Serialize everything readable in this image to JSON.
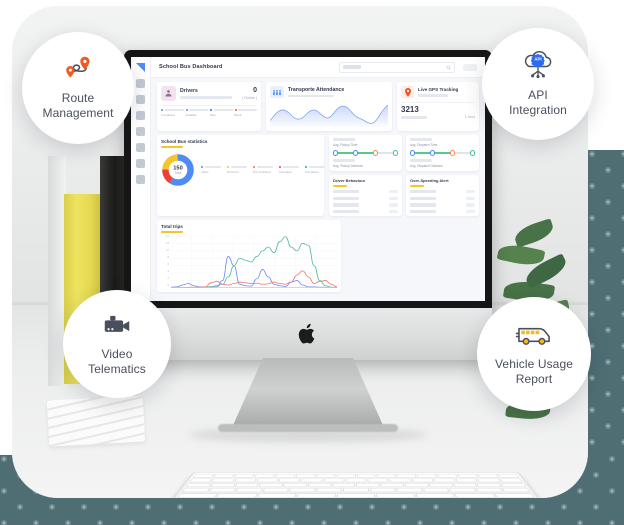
{
  "badges": [
    {
      "id": "route-management",
      "label": "Route\nManagement",
      "icon": "map-pin-route-icon",
      "icon_color": "#ef5a22"
    },
    {
      "id": "api-integration",
      "label": "API\nIntegration",
      "icon": "api-cloud-icon",
      "icon_color": "#2a6df4",
      "icon_text": "API"
    },
    {
      "id": "video-telematics",
      "label": "Video\nTelematics",
      "icon": "video-camera-icon",
      "icon_color": "#4a4f5c"
    },
    {
      "id": "vehicle-usage-report",
      "label": "Vehicle Usage\nReport",
      "icon": "school-bus-icon",
      "icon_color": "#f5b91d"
    }
  ],
  "dashboard": {
    "title": "School Bus Dashboard",
    "search": {
      "placeholder": "",
      "icon": "search-icon"
    },
    "sidebar": {
      "item_count": 8,
      "active_index": 0
    },
    "cards": {
      "drivers": {
        "title": "Drivers",
        "value": "0",
        "status": "( Online )",
        "icon": "driver-avatar-icon",
        "footer": [
          {
            "label": "Completed",
            "color": "#4e8cf5"
          },
          {
            "label": "Available",
            "color": "#4e8cf5"
          },
          {
            "label": "New",
            "color": "#2a6df4"
          },
          {
            "label": "Block",
            "color": "#ef5a22"
          }
        ]
      },
      "attendance": {
        "title": "Transporte Attendance",
        "icon": "attendance-people-icon",
        "chart": {
          "type": "area",
          "points": [
            6,
            12,
            9,
            14,
            10,
            8,
            13,
            20,
            16,
            9,
            5,
            10,
            16,
            20,
            14,
            7,
            3,
            2,
            9,
            18,
            20
          ]
        }
      },
      "gps": {
        "title": "Live GPS Tracking",
        "icon": "gps-pin-icon",
        "value": "3213",
        "time": "1 hour"
      },
      "statistics": {
        "title": "School Bus statistics",
        "donut_value": "150",
        "donut_caption": "Total",
        "legend": [
          {
            "label": "Active",
            "color": "#4e8cf5"
          },
          {
            "label": "No Driver",
            "color": "#f6c52a"
          },
          {
            "label": "Not confirmed",
            "color": "#f0703c"
          },
          {
            "label": "Cancelled",
            "color": "#ea4335"
          },
          {
            "label": "Completed",
            "color": "#1fa9a0"
          }
        ]
      },
      "total_trips": {
        "title": "Total trips"
      },
      "avg_pickup_time": {
        "label": "Avg. Pickup Time"
      },
      "avg_pickup_distance": {
        "label": "Avg. Pickup Distance"
      },
      "avg_dispatch_time": {
        "label": "Avg. Dispatch Time"
      },
      "avg_dispatch_distance": {
        "label": "Avg. Dispatch Distance"
      },
      "driver_behaviour": {
        "title": "Driver Behaviour",
        "row_count": 4
      },
      "over_speeding": {
        "title": "Over-Speeding Alert",
        "row_count": 4
      }
    }
  },
  "chart_data": {
    "type": "line",
    "title": "Total trips",
    "xlabel": "",
    "ylabel": "",
    "ylim": [
      0,
      14
    ],
    "yticks": [
      "14",
      "12",
      "10",
      "8",
      "6",
      "4",
      "2",
      "0"
    ],
    "grid": true,
    "legend_position": "none",
    "x": [
      0,
      1,
      2,
      3,
      4,
      5,
      6,
      7,
      8,
      9,
      10,
      11,
      12,
      13,
      14,
      15,
      16,
      17,
      18,
      19,
      20,
      21,
      22,
      23,
      24,
      25,
      26,
      27,
      28,
      29
    ],
    "series": [
      {
        "name": "series-green",
        "color": "#4fbf8b",
        "values": [
          0,
          0,
          0,
          0,
          0,
          0,
          0.2,
          0.4,
          0.6,
          1,
          3,
          6,
          8,
          7.5,
          7,
          8.5,
          10,
          11,
          9.5,
          12.5,
          13.8,
          11,
          10,
          12,
          11.5,
          6,
          2,
          0.6,
          0.2,
          0.1
        ]
      },
      {
        "name": "series-blue",
        "color": "#6b8bf5",
        "values": [
          0.2,
          0.3,
          0.8,
          1.2,
          0.6,
          0.3,
          0.2,
          0.2,
          0.3,
          2,
          8.5,
          6,
          1,
          0.6,
          0.5,
          2.5,
          5,
          3,
          1,
          0.6,
          0.4,
          1.6,
          2,
          0.8,
          0.3,
          0.3,
          0.2,
          0.2,
          0.2,
          0.1
        ]
      },
      {
        "name": "series-red",
        "color": "#ef7070",
        "values": [
          0.1,
          0.1,
          0.1,
          0.2,
          0.2,
          0.2,
          0.3,
          1.4,
          1.8,
          1,
          0.8,
          1.2,
          1.6,
          1.4,
          1.2,
          1.3,
          1,
          1.1,
          1.6,
          1.2,
          1,
          1.6,
          3.5,
          4.6,
          3,
          1.2,
          1.8,
          2,
          1,
          0.3
        ]
      }
    ]
  },
  "hardware": {
    "device": "imac-desktop",
    "logo": "apple-logo",
    "keyboard": "apple-keyboard"
  },
  "colors": {
    "accent_yellow": "#f6c52a",
    "accent_blue": "#4e8cf5",
    "background_teal": "#4f6e74",
    "orange": "#ef5a22"
  }
}
